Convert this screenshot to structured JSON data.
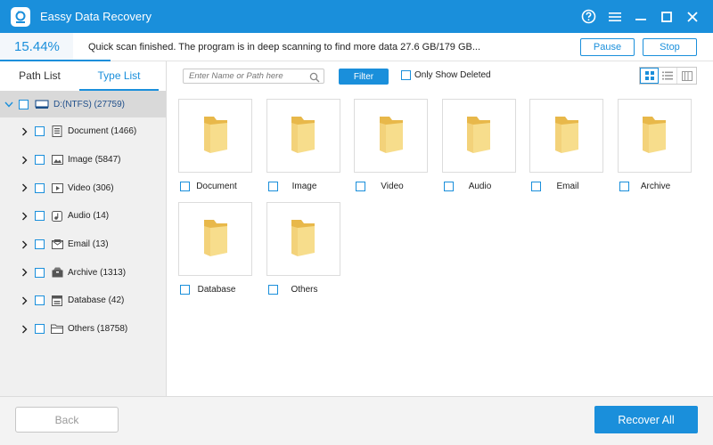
{
  "window": {
    "title": "Eassy Data Recovery",
    "accent": "#1a8fdb",
    "controls": [
      "help-icon",
      "menu-icon",
      "minimize-icon",
      "close-icon"
    ]
  },
  "scan": {
    "percent_label": "15.44%",
    "progress_fraction": 0.1544,
    "status": "Quick scan finished. The program is in deep scanning to find more data 27.6 GB/179 GB...",
    "pause_label": "Pause",
    "stop_label": "Stop"
  },
  "sidebar": {
    "tabs": [
      {
        "label": "Path List",
        "active": false
      },
      {
        "label": "Type List",
        "active": true
      }
    ],
    "root": {
      "label": "D:(NTFS) (27759)",
      "icon": "drive-icon"
    },
    "items": [
      {
        "label": "Document (1466)",
        "icon": "document-icon"
      },
      {
        "label": "Image (5847)",
        "icon": "image-icon"
      },
      {
        "label": "Video (306)",
        "icon": "video-icon"
      },
      {
        "label": "Audio (14)",
        "icon": "audio-icon"
      },
      {
        "label": "Email (13)",
        "icon": "email-icon"
      },
      {
        "label": "Archive (1313)",
        "icon": "archive-icon"
      },
      {
        "label": "Database (42)",
        "icon": "database-icon"
      },
      {
        "label": "Others (18758)",
        "icon": "folder-icon"
      }
    ]
  },
  "toolbar": {
    "search_placeholder": "Enter Name or Path here",
    "filter_label": "Filter",
    "only_deleted_label": "Only Show Deleted",
    "views": [
      "grid-view-icon",
      "list-view-icon",
      "detail-view-icon"
    ]
  },
  "grid": {
    "items": [
      {
        "label": "Document"
      },
      {
        "label": "Image"
      },
      {
        "label": "Video"
      },
      {
        "label": "Audio"
      },
      {
        "label": "Email"
      },
      {
        "label": "Archive"
      },
      {
        "label": "Database"
      },
      {
        "label": "Others"
      }
    ]
  },
  "footer": {
    "back_label": "Back",
    "recover_label": "Recover All"
  }
}
